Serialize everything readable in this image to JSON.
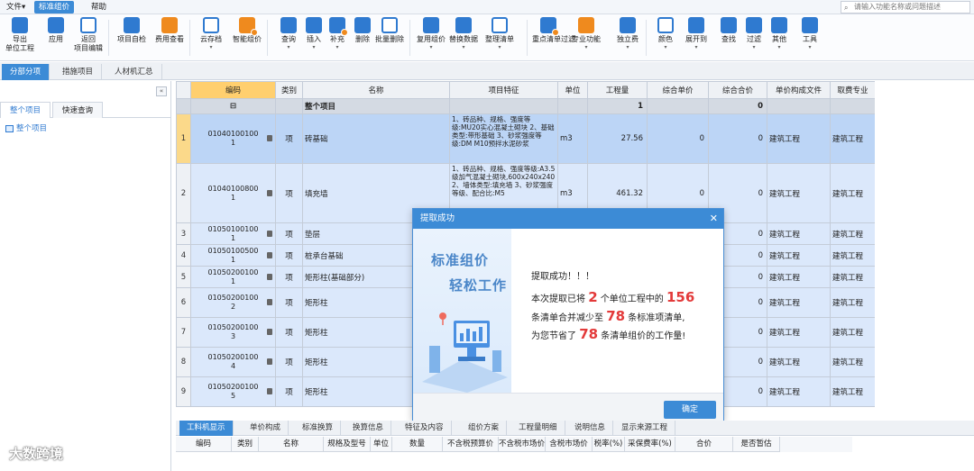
{
  "menu": {
    "file": "文件▾",
    "standard": "标准组价",
    "help": "帮助"
  },
  "search": {
    "placeholder": "请输入功能名称或问题描述"
  },
  "toolbar": [
    {
      "label1": "导出",
      "label2": "单位工程"
    },
    {
      "label1": "应用",
      "label2": ""
    },
    {
      "label1": "返回",
      "label2": "项目编辑"
    },
    {
      "label1": "项目自检",
      "label2": ""
    },
    {
      "label1": "费用查看",
      "label2": ""
    },
    {
      "label1": "云存档",
      "label2": ""
    },
    {
      "label1": "智能组价",
      "label2": ""
    },
    {
      "label1": "查询",
      "label2": ""
    },
    {
      "label1": "插入",
      "label2": ""
    },
    {
      "label1": "补充",
      "label2": ""
    },
    {
      "label1": "删除",
      "label2": ""
    },
    {
      "label1": "批量删除",
      "label2": ""
    },
    {
      "label1": "复用组价",
      "label2": ""
    },
    {
      "label1": "替换数据",
      "label2": ""
    },
    {
      "label1": "整理清单",
      "label2": ""
    },
    {
      "label1": "重点清单过滤",
      "label2": ""
    },
    {
      "label1": "专业功能",
      "label2": ""
    },
    {
      "label1": "独立费",
      "label2": ""
    },
    {
      "label1": "颜色",
      "label2": ""
    },
    {
      "label1": "展开到",
      "label2": ""
    },
    {
      "label1": "查找",
      "label2": ""
    },
    {
      "label1": "过滤",
      "label2": ""
    },
    {
      "label1": "其他",
      "label2": ""
    },
    {
      "label1": "工具",
      "label2": ""
    }
  ],
  "tabs": [
    "分部分项",
    "措施项目",
    "人材机汇总"
  ],
  "left": {
    "tabs": [
      "整个项目",
      "快速查询"
    ],
    "tree_root": "整个项目"
  },
  "grid": {
    "headers": [
      "",
      "编码",
      "类别",
      "名称",
      "项目特征",
      "单位",
      "工程量",
      "综合单价",
      "综合合价",
      "单价构成文件",
      "取费专业"
    ],
    "parent": {
      "name": "整个项目",
      "qty": "1",
      "total": "0"
    },
    "rows": [
      {
        "n": "1",
        "code1": "01040100100",
        "code2": "1",
        "cat": "项",
        "name": "砖基础",
        "feat": "1、砖品种、规格、强度等级:MU20实心混凝土砌块\n2、基础类型:带形基础\n3、砂浆强度等级:DM M10预拌水泥砂浆",
        "unit": "m3",
        "qty": "27.56",
        "price": "0",
        "total": "0",
        "file": "建筑工程",
        "spec": "建筑工程"
      },
      {
        "n": "2",
        "code1": "01040100800",
        "code2": "1",
        "cat": "项",
        "name": "填充墙",
        "feat": "1、砖品种、规格、强度等级:A3.5级加气混凝土砌块,600x240x240\n2、墙体类型:填充墙\n3、砂浆强度等级、配合比:M5",
        "unit": "m3",
        "qty": "461.32",
        "price": "0",
        "total": "0",
        "file": "建筑工程",
        "spec": "建筑工程"
      },
      {
        "n": "3",
        "code1": "01050100100",
        "code2": "1",
        "cat": "项",
        "name": "垫层",
        "feat": "",
        "unit": "",
        "qty": "",
        "price": "",
        "total": "0",
        "file": "建筑工程",
        "spec": "建筑工程"
      },
      {
        "n": "4",
        "code1": "01050100500",
        "code2": "1",
        "cat": "项",
        "name": "桩承台基础",
        "feat": "",
        "unit": "",
        "qty": "",
        "price": "",
        "total": "0",
        "file": "建筑工程",
        "spec": "建筑工程"
      },
      {
        "n": "5",
        "code1": "01050200100",
        "code2": "1",
        "cat": "项",
        "name": "矩形柱(基础部分)",
        "feat": "",
        "unit": "",
        "qty": "",
        "price": "",
        "total": "0",
        "file": "建筑工程",
        "spec": "建筑工程"
      },
      {
        "n": "6",
        "code1": "01050200100",
        "code2": "2",
        "cat": "项",
        "name": "矩形柱",
        "feat": "",
        "unit": "",
        "qty": "",
        "price": "",
        "total": "0",
        "file": "建筑工程",
        "spec": "建筑工程"
      },
      {
        "n": "7",
        "code1": "01050200100",
        "code2": "3",
        "cat": "项",
        "name": "矩形柱",
        "feat": "",
        "unit": "",
        "qty": "",
        "price": "",
        "total": "0",
        "file": "建筑工程",
        "spec": "建筑工程"
      },
      {
        "n": "8",
        "code1": "01050200100",
        "code2": "4",
        "cat": "项",
        "name": "矩形柱",
        "feat": "",
        "unit": "",
        "qty": "",
        "price": "",
        "total": "0",
        "file": "建筑工程",
        "spec": "建筑工程"
      },
      {
        "n": "9",
        "code1": "01050200100",
        "code2": "5",
        "cat": "项",
        "name": "矩形柱",
        "feat": "",
        "unit": "",
        "qty": "",
        "price": "",
        "total": "0",
        "file": "建筑工程",
        "spec": "建筑工程"
      }
    ]
  },
  "dialog": {
    "title": "提取成功",
    "slogan1": "标准组价",
    "slogan2": "轻松工作",
    "line1": "提取成功！！！",
    "line2a": "本次提取已将",
    "n_units": "2",
    "line2b": "个单位工程中的",
    "n_items": "156",
    "line3a": "条清单合并减少至",
    "n_merged": "78",
    "line3b": "条标准项清单,",
    "line4a": "为您节省了",
    "n_saved": "78",
    "line4b": "条清单组价的工作量!",
    "ok": "确定"
  },
  "bottom": {
    "tabs": [
      "工料机显示",
      "单价构成",
      "标准换算",
      "换算信息",
      "特征及内容",
      "组价方案",
      "工程量明细",
      "说明信息",
      "显示来源工程"
    ],
    "headers": [
      "编码",
      "类别",
      "名称",
      "规格及型号",
      "单位",
      "数量",
      "不含税预算价",
      "不含税市场价",
      "含税市场价",
      "税率(%)",
      "采保费率(%)",
      "合价",
      "是否暂估"
    ]
  },
  "watermark": "大数跨境"
}
